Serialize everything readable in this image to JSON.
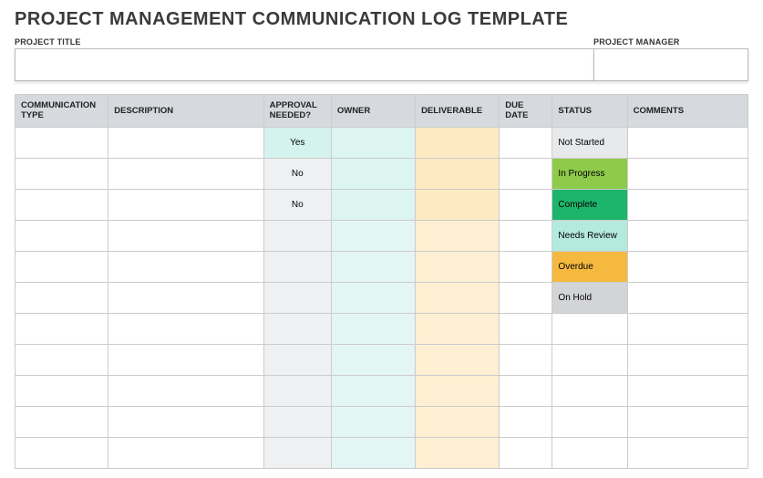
{
  "header": {
    "title": "PROJECT MANAGEMENT COMMUNICATION LOG TEMPLATE"
  },
  "meta": {
    "project_title_label": "PROJECT TITLE",
    "project_title_value": "",
    "project_manager_label": "PROJECT MANAGER",
    "project_manager_value": ""
  },
  "table": {
    "columns": {
      "type": "COMMUNICATION TYPE",
      "description": "DESCRIPTION",
      "approval": "APPROVAL NEEDED?",
      "owner": "OWNER",
      "deliverable": "DELIVERABLE",
      "due": "DUE DATE",
      "status": "STATUS",
      "comments": "COMMENTS"
    },
    "rows": [
      {
        "type": "",
        "description": "",
        "approval": "Yes",
        "owner": "",
        "deliverable": "",
        "due": "",
        "status": "Not Started",
        "status_class": "st-not-started",
        "comments": "",
        "approval_yes": true
      },
      {
        "type": "",
        "description": "",
        "approval": "No",
        "owner": "",
        "deliverable": "",
        "due": "",
        "status": "In Progress",
        "status_class": "st-in-progress",
        "comments": "",
        "approval_yes": false
      },
      {
        "type": "",
        "description": "",
        "approval": "No",
        "owner": "",
        "deliverable": "",
        "due": "",
        "status": "Complete",
        "status_class": "st-complete",
        "comments": "",
        "approval_yes": false
      },
      {
        "type": "",
        "description": "",
        "approval": "",
        "owner": "",
        "deliverable": "",
        "due": "",
        "status": "Needs Review",
        "status_class": "st-needs-review",
        "comments": "",
        "approval_yes": false
      },
      {
        "type": "",
        "description": "",
        "approval": "",
        "owner": "",
        "deliverable": "",
        "due": "",
        "status": "Overdue",
        "status_class": "st-overdue",
        "comments": "",
        "approval_yes": false
      },
      {
        "type": "",
        "description": "",
        "approval": "",
        "owner": "",
        "deliverable": "",
        "due": "",
        "status": "On Hold",
        "status_class": "st-on-hold",
        "comments": "",
        "approval_yes": false
      },
      {
        "type": "",
        "description": "",
        "approval": "",
        "owner": "",
        "deliverable": "",
        "due": "",
        "status": "",
        "status_class": "",
        "comments": "",
        "approval_yes": false
      },
      {
        "type": "",
        "description": "",
        "approval": "",
        "owner": "",
        "deliverable": "",
        "due": "",
        "status": "",
        "status_class": "",
        "comments": "",
        "approval_yes": false
      },
      {
        "type": "",
        "description": "",
        "approval": "",
        "owner": "",
        "deliverable": "",
        "due": "",
        "status": "",
        "status_class": "",
        "comments": "",
        "approval_yes": false
      },
      {
        "type": "",
        "description": "",
        "approval": "",
        "owner": "",
        "deliverable": "",
        "due": "",
        "status": "",
        "status_class": "",
        "comments": "",
        "approval_yes": false
      },
      {
        "type": "",
        "description": "",
        "approval": "",
        "owner": "",
        "deliverable": "",
        "due": "",
        "status": "",
        "status_class": "",
        "comments": "",
        "approval_yes": false
      }
    ]
  }
}
